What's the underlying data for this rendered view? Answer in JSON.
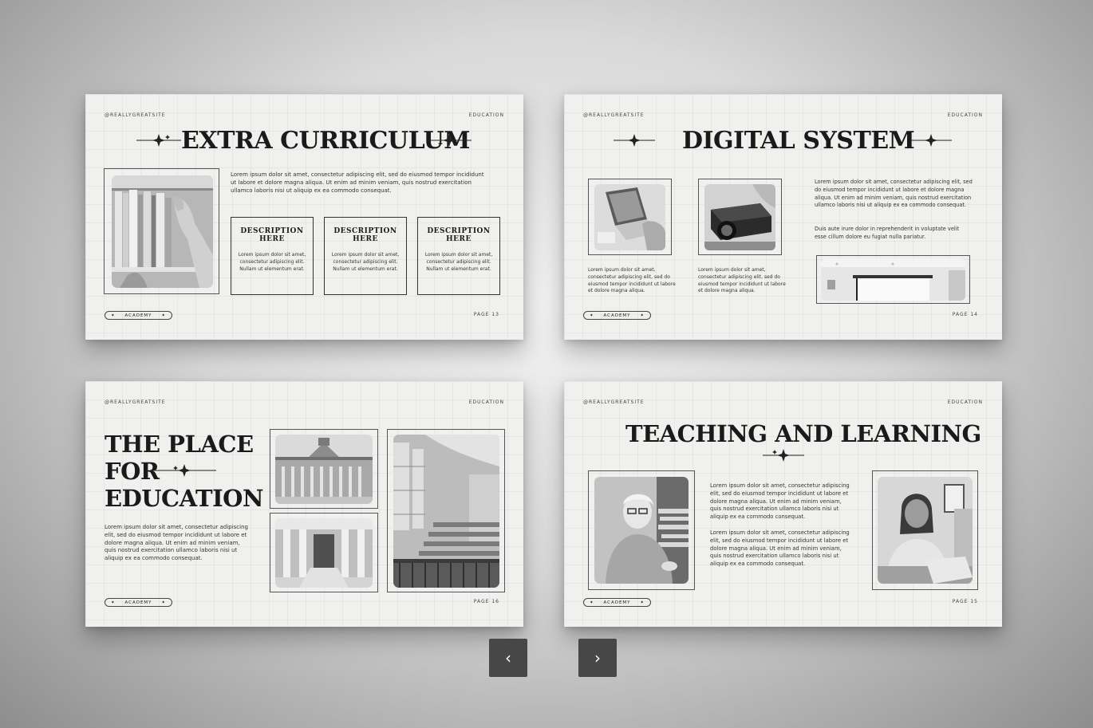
{
  "slides": [
    {
      "handle": "@REALLYGREATSITE",
      "category": "EDUCATION",
      "title": "EXTRA CURRICULUM",
      "body": "Lorem ipsum dolor sit amet, consectetur adipiscing elit, sed do eiusmod tempor incididunt ut labore et dolore magna aliqua. Ut enim ad minim veniam, quis nostrud exercitation ullamco laboris nisi ut aliquip ex ea commodo consequat.",
      "descriptions": [
        {
          "title": "DESCRIPTION HERE",
          "text": "Lorem ipsum dolor sit amet, consectetur adipiscing elit. Nullam ut elementum erat."
        },
        {
          "title": "DESCRIPTION HERE",
          "text": "Lorem ipsum dolor sit amet, consectetur adipiscing elit. Nullam ut elementum erat."
        },
        {
          "title": "DESCRIPTION HERE",
          "text": "Lorem ipsum dolor sit amet, consectetur adipiscing elit. Nullam ut elementum erat."
        }
      ],
      "footer_tag": "ACADEMY",
      "page": "PAGE 13"
    },
    {
      "handle": "@REALLYGREATSITE",
      "category": "EDUCATION",
      "title": "DIGITAL SYSTEM",
      "caption_1": "Lorem ipsum dolor sit amet, consectetur adipiscing elit, sed do eiusmod tempor incididunt ut labore et dolore magna aliqua.",
      "caption_2": "Lorem ipsum dolor sit amet, consectetur adipiscing elit, sed do eiusmod tempor incididunt ut labore et dolore magna aliqua.",
      "body_1": "Lorem ipsum dolor sit amet, consectetur adipiscing elit, sed do eiusmod tempor incididunt ut labore et dolore magna aliqua. Ut enim ad minim veniam, quis nostrud exercitation ullamco laboris nisi ut aliquip ex ea commodo consequat.",
      "body_2": "Duis aute irure dolor in reprehenderit in voluptate velit esse cillum dolore eu fugiat nulla pariatur.",
      "footer_tag": "ACADEMY",
      "page": "PAGE 14"
    },
    {
      "handle": "@REALLYGREATSITE",
      "category": "EDUCATION",
      "title_line1": "THE PLACE",
      "title_line2": "FOR",
      "title_line3": "EDUCATION",
      "body": "Lorem ipsum dolor sit amet, consectetur adipiscing elit, sed do eiusmod tempor incididunt ut labore et dolore magna aliqua. Ut enim ad minim veniam, quis nostrud exercitation ullamco laboris nisi ut aliquip ex ea commodo consequat.",
      "footer_tag": "ACADEMY",
      "page": "PAGE 16"
    },
    {
      "handle": "@REALLYGREATSITE",
      "category": "EDUCATION",
      "title": "TEACHING AND LEARNING",
      "body_1": "Lorem ipsum dolor sit amet, consectetur adipiscing elit, sed do eiusmod tempor incididunt ut labore et dolore magna aliqua. Ut enim ad minim veniam, quis nostrud exercitation ullamco laboris nisi ut aliquip ex ea commodo consequat.",
      "body_2": "Lorem ipsum dolor sit amet, consectetur adipiscing elit, sed do eiusmod tempor incididunt ut labore et dolore magna aliqua. Ut enim ad minim veniam, quis nostrud exercitation ullamco laboris nisi ut aliquip ex ea commodo consequat.",
      "footer_tag": "ACADEMY",
      "page": "PAGE 15"
    }
  ],
  "nav": {
    "prev_icon": "chevron-left-icon",
    "next_icon": "chevron-right-icon",
    "prev_glyph": "‹",
    "next_glyph": "›"
  },
  "colors": {
    "slide_bg": "#f0f0ee",
    "ink": "#1a1a1a",
    "nav_button": "#474747"
  }
}
